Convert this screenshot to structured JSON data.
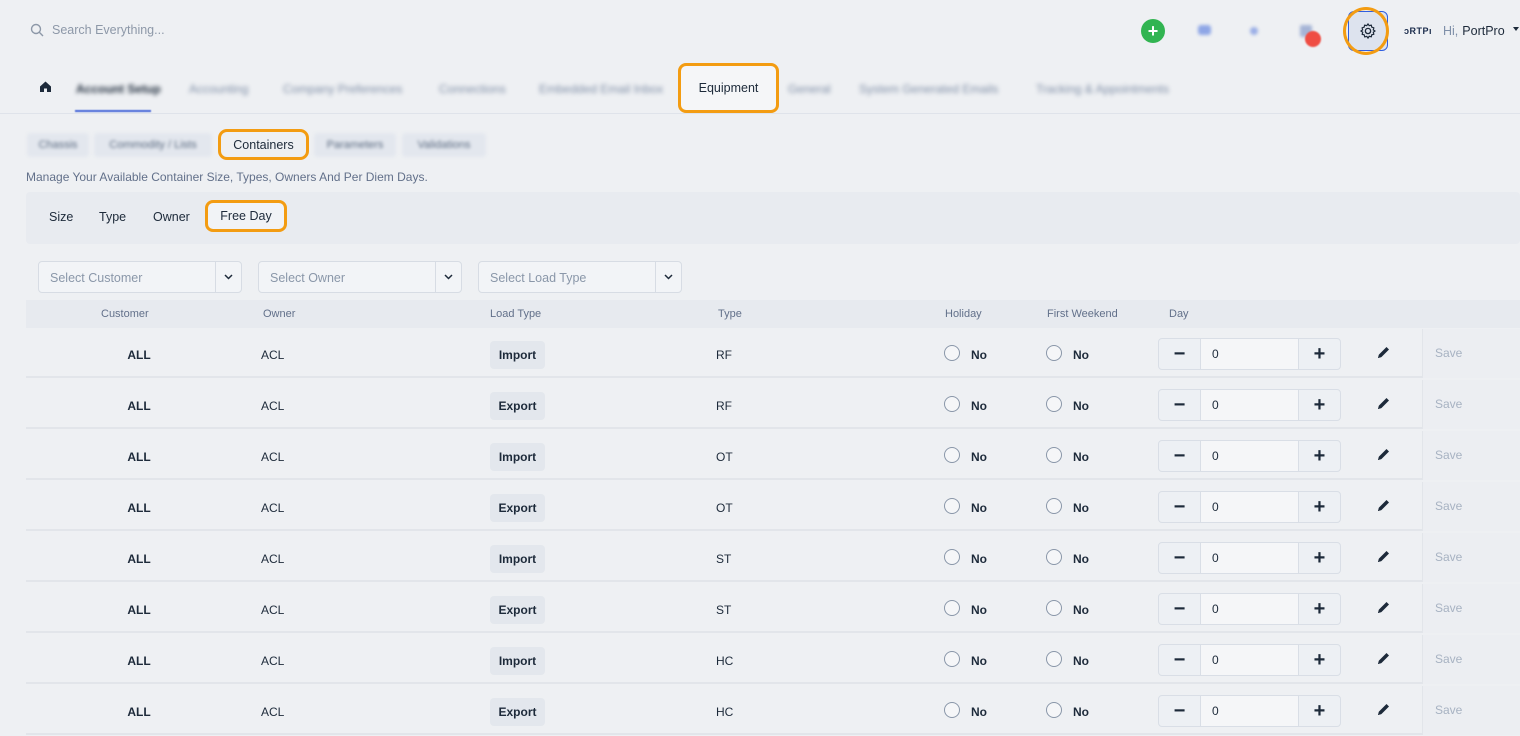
{
  "topbar": {
    "search_placeholder": "Search Everything...",
    "logo_text": "ɔRTPı",
    "greeting_hi": "Hi,",
    "user_name": "PortPro"
  },
  "main_nav": {
    "items": [
      {
        "label": "Account Setup"
      },
      {
        "label": "Accounting"
      },
      {
        "label": "Company Preferences"
      },
      {
        "label": "Connections"
      },
      {
        "label": "Embedded Email Inbox"
      },
      {
        "label": "Equipment"
      },
      {
        "label": "General"
      },
      {
        "label": "System Generated Emails"
      },
      {
        "label": "Tracking & Appointments"
      }
    ]
  },
  "sub_tabs": {
    "items": [
      {
        "label": "Chassis"
      },
      {
        "label": "Commodity / Lists"
      },
      {
        "label": "Containers"
      },
      {
        "label": "Parameters"
      },
      {
        "label": "Validations"
      }
    ],
    "description": "Manage Your Available Container Size, Types, Owners And Per Diem Days."
  },
  "section_tabs": [
    {
      "label": "Size"
    },
    {
      "label": "Type"
    },
    {
      "label": "Owner"
    },
    {
      "label": "Free Day"
    }
  ],
  "filters": {
    "customer": "Select Customer",
    "owner": "Select Owner",
    "load_type": "Select Load Type"
  },
  "table": {
    "headers": [
      "Customer",
      "Owner",
      "Load Type",
      "Type",
      "Holiday",
      "First Weekend",
      "Day"
    ],
    "rows": [
      {
        "customer": "ALL",
        "owner": "ACL",
        "load_type": "Import",
        "type": "RF",
        "holiday": "No",
        "first_weekend": "No",
        "day": "0",
        "save": "Save"
      },
      {
        "customer": "ALL",
        "owner": "ACL",
        "load_type": "Export",
        "type": "RF",
        "holiday": "No",
        "first_weekend": "No",
        "day": "0",
        "save": "Save"
      },
      {
        "customer": "ALL",
        "owner": "ACL",
        "load_type": "Import",
        "type": "OT",
        "holiday": "No",
        "first_weekend": "No",
        "day": "0",
        "save": "Save"
      },
      {
        "customer": "ALL",
        "owner": "ACL",
        "load_type": "Export",
        "type": "OT",
        "holiday": "No",
        "first_weekend": "No",
        "day": "0",
        "save": "Save"
      },
      {
        "customer": "ALL",
        "owner": "ACL",
        "load_type": "Import",
        "type": "ST",
        "holiday": "No",
        "first_weekend": "No",
        "day": "0",
        "save": "Save"
      },
      {
        "customer": "ALL",
        "owner": "ACL",
        "load_type": "Export",
        "type": "ST",
        "holiday": "No",
        "first_weekend": "No",
        "day": "0",
        "save": "Save"
      },
      {
        "customer": "ALL",
        "owner": "ACL",
        "load_type": "Import",
        "type": "HC",
        "holiday": "No",
        "first_weekend": "No",
        "day": "0",
        "save": "Save"
      },
      {
        "customer": "ALL",
        "owner": "ACL",
        "load_type": "Export",
        "type": "HC",
        "holiday": "No",
        "first_weekend": "No",
        "day": "0",
        "save": "Save"
      }
    ]
  },
  "colors": {
    "highlight": "#f39c12",
    "accent": "#2f5ee0",
    "add_button": "#31b451",
    "badge": "#ef4d43"
  }
}
